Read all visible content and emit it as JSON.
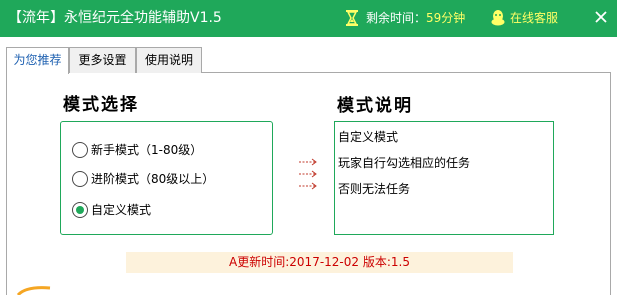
{
  "window": {
    "title": "【流年】永恒纪元全功能辅助V1.5",
    "remaining_label": "剩余时间：",
    "remaining_value": "59分钟",
    "service_label": "在线客服",
    "colors": {
      "titlebar": "#1fa85a",
      "accent": "#ffff66"
    }
  },
  "tabs": [
    {
      "label": "为您推荐",
      "active": true
    },
    {
      "label": "更多设置",
      "active": false
    },
    {
      "label": "使用说明",
      "active": false
    }
  ],
  "mode_select": {
    "heading": "模式选择",
    "options": [
      {
        "label": "新手模式（1-80级）",
        "checked": false
      },
      {
        "label": "进阶模式（80级以上）",
        "checked": false
      },
      {
        "label": "自定义模式",
        "checked": true
      }
    ]
  },
  "mode_desc": {
    "heading": "模式说明",
    "lines": [
      "自定义模式",
      "玩家自行勾选相应的任务",
      "否则无法任务"
    ]
  },
  "footer": {
    "text": "A更新时间:2017-12-02 版本:1.5"
  },
  "icons": [
    "hourglass-icon",
    "qq-penguin-icon",
    "close-icon",
    "arrow-right-icon"
  ]
}
